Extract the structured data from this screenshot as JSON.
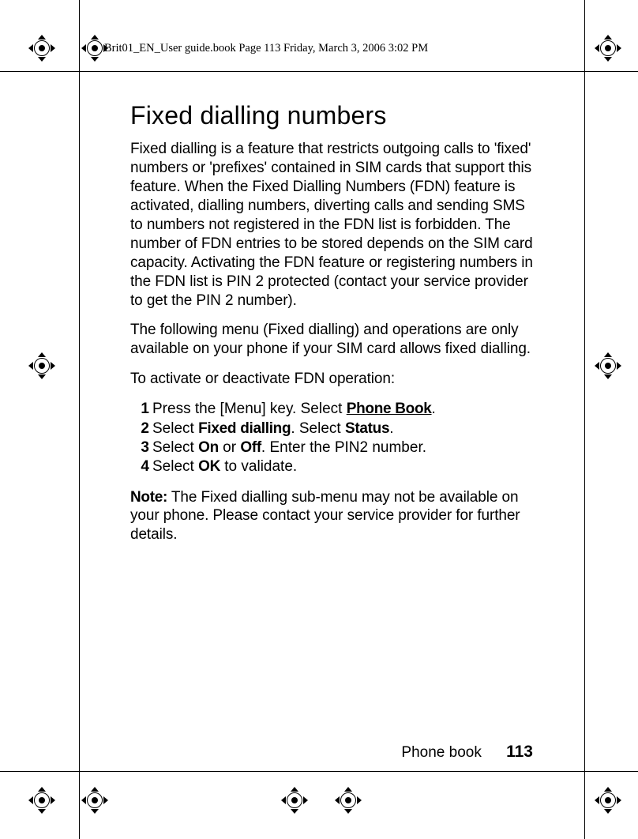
{
  "header": {
    "running_head": "Brit01_EN_User guide.book  Page 113  Friday, March 3, 2006  3:02 PM"
  },
  "title": "Fixed dialling numbers",
  "para1": "Fixed dialling is a feature that restricts outgoing calls to 'fixed' numbers or 'prefixes' contained in SIM cards that support this feature. When the Fixed Dialling Numbers (FDN) feature is activated, dialling numbers, diverting calls and sending SMS to numbers not registered in the FDN list is forbidden. The number of FDN entries to be stored depends on the SIM card capacity. Activating the FDN feature or registering numbers in the FDN list is PIN 2 protected (contact your service provider to get the PIN 2 number).",
  "para2": "The following menu (Fixed dialling) and operations are only available on your phone if your SIM card allows fixed dialling.",
  "para3": "To activate or deactivate FDN operation:",
  "steps": {
    "s1a": "Press the [Menu] key. Select ",
    "s1b": "Phone Book",
    "s1c": ".",
    "s2a": "Select ",
    "s2b": "Fixed dialling",
    "s2c": ". Select ",
    "s2d": "Status",
    "s2e": ".",
    "s3a": "Select ",
    "s3b": "On",
    "s3c": " or ",
    "s3d": "Off",
    "s3e": ". Enter the PIN2 number.",
    "s4a": "Select ",
    "s4b": "OK",
    "s4c": " to validate."
  },
  "note_label": "Note:",
  "note_body": " The Fixed dialling sub-menu may not be available on your phone. Please contact your service provider for further details.",
  "footer": {
    "section": "Phone book",
    "page": "113"
  }
}
